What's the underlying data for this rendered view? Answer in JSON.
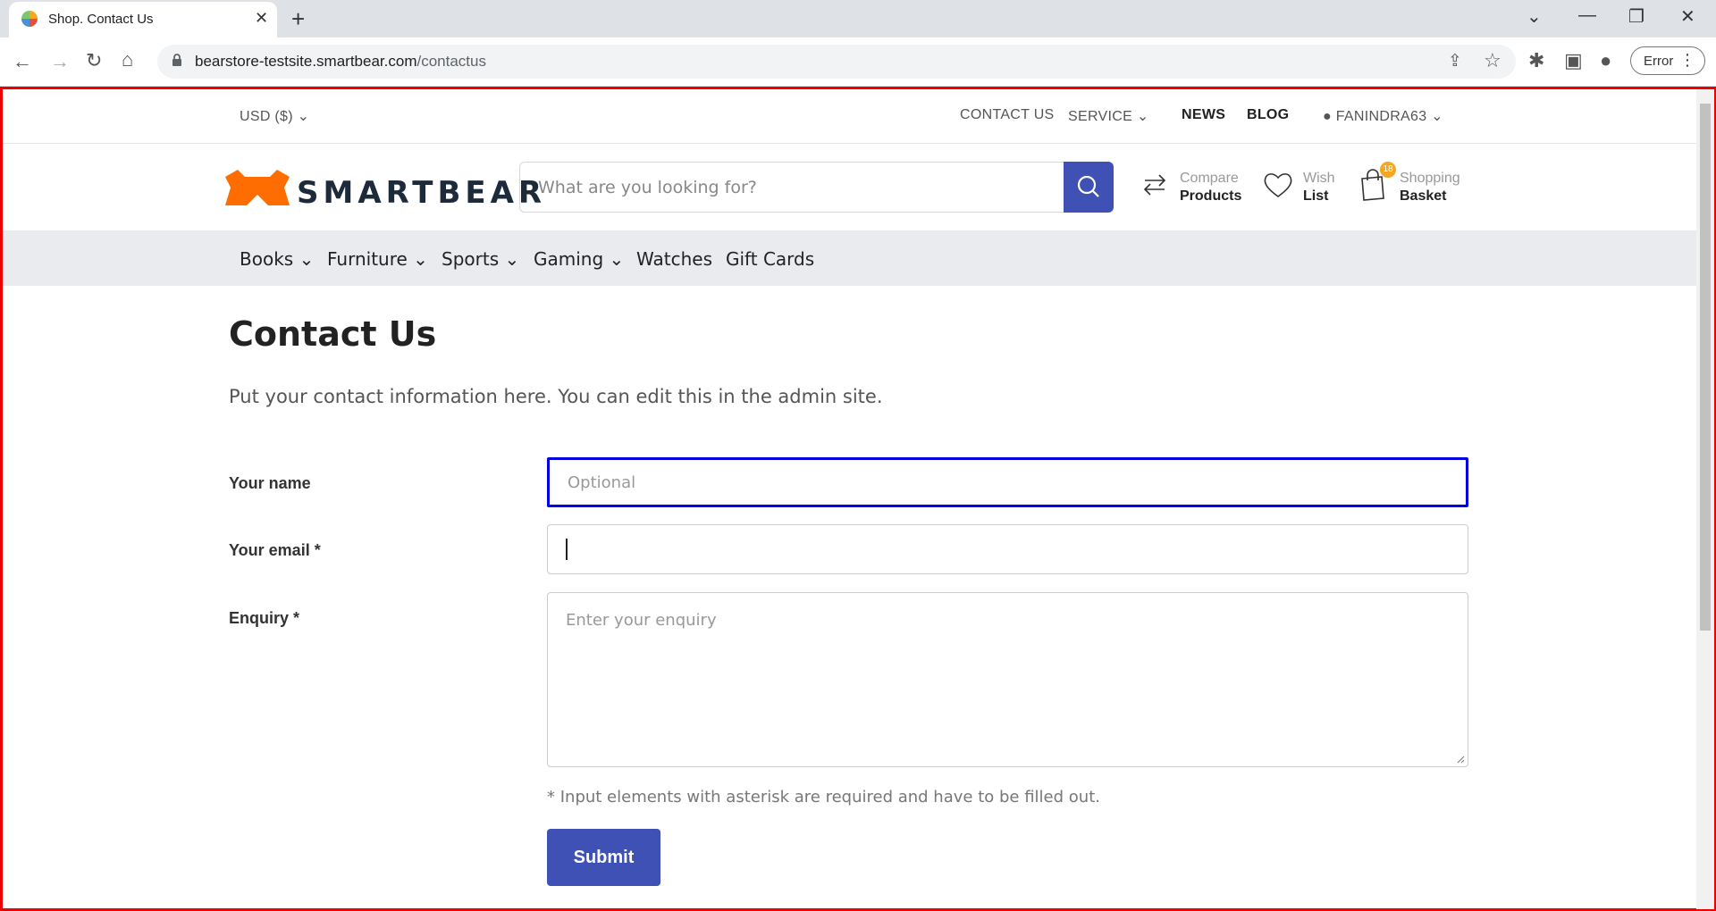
{
  "browser": {
    "tab_title": "Shop. Contact Us",
    "url_host": "bearstore-testsite.smartbear.com",
    "url_path": "/contactus",
    "profile_status": "Error"
  },
  "topbar": {
    "currency": "USD  ($)",
    "contact_us": "CONTACT US",
    "service": "SERVICE",
    "news": "NEWS",
    "blog": "BLOG",
    "account": "FANINDRA63"
  },
  "header": {
    "logo_text": "SMARTBEAR",
    "search_placeholder": "What are you looking for?",
    "compare_small": "Compare",
    "compare_big": "Products",
    "wish_small": "Wish",
    "wish_big": "List",
    "basket_small": "Shopping",
    "basket_big": "Basket",
    "basket_count": "18"
  },
  "nav": {
    "items": [
      "Books",
      "Furniture",
      "Sports",
      "Gaming",
      "Watches",
      "Gift Cards"
    ]
  },
  "content": {
    "title": "Contact Us",
    "intro": "Put your contact information here. You can edit this in the admin site.",
    "name_label": "Your name",
    "name_placeholder": "Optional",
    "email_label": "Your email *",
    "enquiry_label": "Enquiry *",
    "enquiry_placeholder": "Enter your enquiry",
    "required_note": "* Input elements with asterisk are required and have to be filled out.",
    "submit_label": "Submit"
  },
  "colors": {
    "accent": "#3f51b5",
    "frame": "#e00000",
    "focus": "#0000e0",
    "logo_orange": "#ff6d00"
  }
}
